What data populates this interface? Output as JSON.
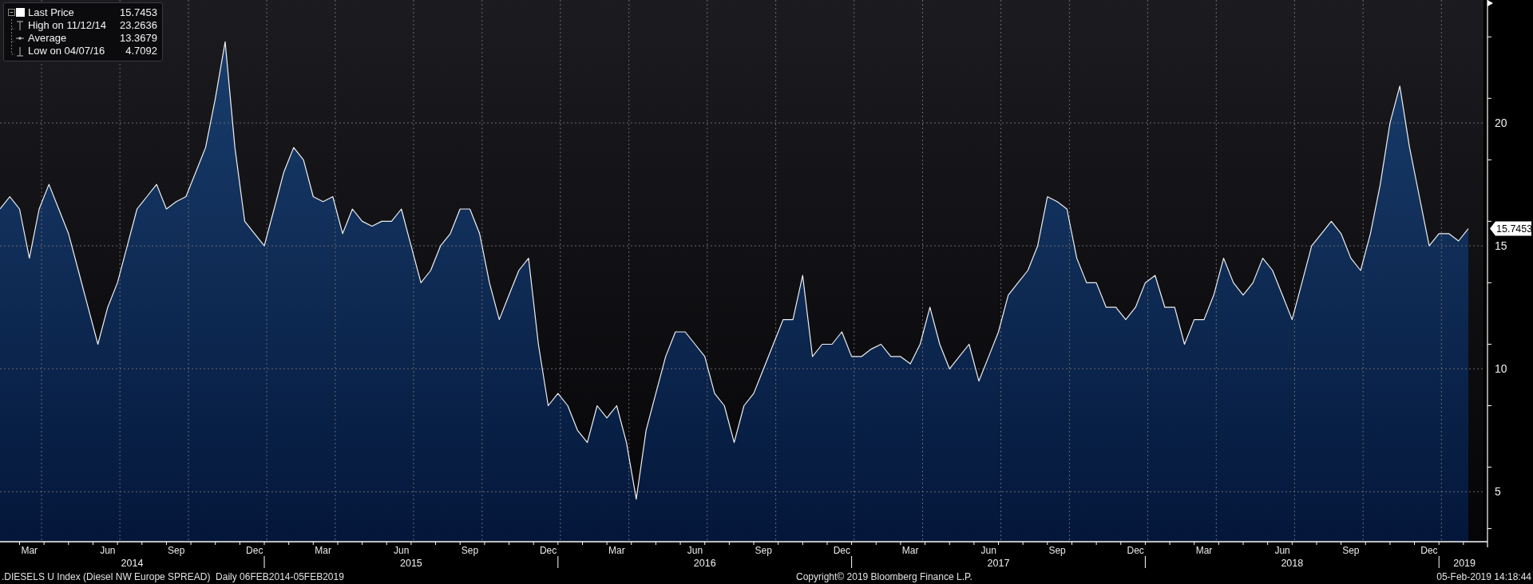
{
  "legend": {
    "items": [
      {
        "kind": "last",
        "label": "Last Price",
        "value": "15.7453"
      },
      {
        "kind": "high",
        "label": "High on 11/12/14",
        "value": "23.2636"
      },
      {
        "kind": "average",
        "label": "Average",
        "value": "13.3679"
      },
      {
        "kind": "low",
        "label": "Low on 04/07/16",
        "value": "4.7092"
      }
    ]
  },
  "price_tag": "15.7453",
  "chart": {
    "chart_data": {
      "type": "area",
      "grid": true,
      "ylim": [
        3,
        25
      ],
      "yticks": [
        5,
        10,
        15,
        20
      ],
      "categories": [
        null,
        null,
        null,
        "Mar",
        null,
        null,
        null,
        null,
        null,
        null,
        null,
        "Jun",
        null,
        null,
        null,
        null,
        null,
        null,
        "Sep",
        null,
        null,
        null,
        null,
        null,
        null,
        null,
        "Dec",
        null,
        null,
        null,
        null,
        null,
        null,
        "Mar",
        null,
        null,
        null,
        null,
        null,
        null,
        null,
        "Jun",
        null,
        null,
        null,
        null,
        null,
        null,
        "Sep",
        null,
        null,
        null,
        null,
        null,
        null,
        null,
        "Dec",
        null,
        null,
        null,
        null,
        null,
        null,
        "Mar",
        null,
        null,
        null,
        null,
        null,
        null,
        null,
        "Jun",
        null,
        null,
        null,
        null,
        null,
        null,
        "Sep",
        null,
        null,
        null,
        null,
        null,
        null,
        null,
        "Dec",
        null,
        null,
        null,
        null,
        null,
        null,
        "Mar",
        null,
        null,
        null,
        null,
        null,
        null,
        null,
        "Jun",
        null,
        null,
        null,
        null,
        null,
        null,
        "Sep",
        null,
        null,
        null,
        null,
        null,
        null,
        null,
        "Dec",
        null,
        null,
        null,
        null,
        null,
        null,
        "Mar",
        null,
        null,
        null,
        null,
        null,
        null,
        null,
        "Jun",
        null,
        null,
        null,
        null,
        null,
        null,
        "Sep",
        null,
        null,
        null,
        null,
        null,
        null,
        null,
        "Dec",
        null,
        null,
        null,
        null
      ],
      "values": [
        16.5,
        17,
        16.5,
        14.5,
        16.5,
        17.5,
        16.5,
        15.5,
        14,
        12.5,
        11,
        12.5,
        13.5,
        15,
        16.5,
        17,
        17.5,
        16.5,
        16.8,
        17,
        18,
        19,
        21,
        23.3,
        19,
        16,
        15.5,
        15,
        16.5,
        18,
        19,
        18.5,
        17,
        16.8,
        17,
        15.5,
        16.5,
        16,
        15.8,
        16,
        16,
        16.5,
        15,
        13.5,
        14,
        15,
        15.5,
        16.5,
        16.5,
        15.5,
        13.5,
        12,
        13,
        14,
        14.5,
        11,
        8.5,
        9,
        8.5,
        7.5,
        7,
        8.5,
        8,
        8.5,
        7,
        4.7,
        7.5,
        9,
        10.5,
        11.5,
        11.5,
        11,
        10.5,
        9,
        8.5,
        7,
        8.5,
        9,
        10,
        11,
        12,
        12,
        13.8,
        10.5,
        11,
        11,
        11.5,
        10.5,
        10.5,
        10.8,
        11,
        10.5,
        10.5,
        10.2,
        11,
        12.5,
        11,
        10,
        10.5,
        11,
        9.5,
        10.5,
        11.5,
        13,
        13.5,
        14,
        15,
        17,
        16.8,
        16.5,
        14.5,
        13.5,
        13.5,
        12.5,
        12.5,
        12,
        12.5,
        13.5,
        13.8,
        12.5,
        12.5,
        11,
        12,
        12,
        13,
        14.5,
        13.5,
        13,
        13.5,
        14.5,
        14,
        13,
        12,
        13.5,
        15,
        15.5,
        16,
        15.5,
        14.5,
        14,
        15.5,
        17.5,
        20,
        21.5,
        19,
        17,
        15,
        15.5,
        15.5,
        15.2,
        15.7
      ]
    },
    "year_labels": [
      "2014",
      "2015",
      "2016",
      "2017",
      "2018",
      "2019"
    ]
  },
  "footer": {
    "security": ".DIESELS U Index (Diesel NW Europe SPREAD)  Daily 06FEB2014-05FEB2019",
    "copyright": "Copyright© 2019 Bloomberg Finance L.P.",
    "timestamp": "05-Feb-2019 14:18:44"
  }
}
